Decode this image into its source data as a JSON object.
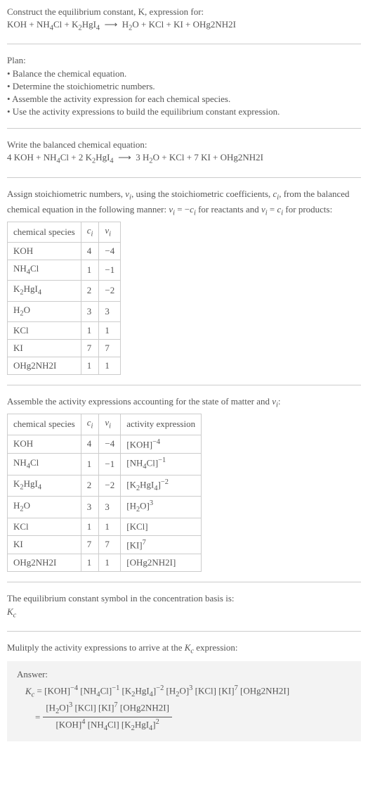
{
  "intro": {
    "line1": "Construct the equilibrium constant, K, expression for:",
    "line2": "KOH + NH₄Cl + K₂HgI₄ ⟶ H₂O + KCl + KI + OHg2NH2I"
  },
  "plan": {
    "heading": "Plan:",
    "items": [
      "• Balance the chemical equation.",
      "• Determine the stoichiometric numbers.",
      "• Assemble the activity expression for each chemical species.",
      "• Use the activity expressions to build the equilibrium constant expression."
    ]
  },
  "balanced": {
    "heading": "Write the balanced chemical equation:",
    "equation": "4 KOH + NH₄Cl + 2 K₂HgI₄ ⟶ 3 H₂O + KCl + 7 KI + OHg2NH2I"
  },
  "assign": {
    "text": "Assign stoichiometric numbers, νᵢ, using the stoichiometric coefficients, cᵢ, from the balanced chemical equation in the following manner: νᵢ = −cᵢ for reactants and νᵢ = cᵢ for products:"
  },
  "table1": {
    "headers": [
      "chemical species",
      "cᵢ",
      "νᵢ"
    ],
    "rows": [
      [
        "KOH",
        "4",
        "−4"
      ],
      [
        "NH₄Cl",
        "1",
        "−1"
      ],
      [
        "K₂HgI₄",
        "2",
        "−2"
      ],
      [
        "H₂O",
        "3",
        "3"
      ],
      [
        "KCl",
        "1",
        "1"
      ],
      [
        "KI",
        "7",
        "7"
      ],
      [
        "OHg2NH2I",
        "1",
        "1"
      ]
    ]
  },
  "assemble": {
    "text": "Assemble the activity expressions accounting for the state of matter and νᵢ:"
  },
  "table2": {
    "headers": [
      "chemical species",
      "cᵢ",
      "νᵢ",
      "activity expression"
    ],
    "rows": [
      [
        "KOH",
        "4",
        "−4",
        "[KOH]⁻⁴"
      ],
      [
        "NH₄Cl",
        "1",
        "−1",
        "[NH₄Cl]⁻¹"
      ],
      [
        "K₂HgI₄",
        "2",
        "−2",
        "[K₂HgI₄]⁻²"
      ],
      [
        "H₂O",
        "3",
        "3",
        "[H₂O]³"
      ],
      [
        "KCl",
        "1",
        "1",
        "[KCl]"
      ],
      [
        "KI",
        "7",
        "7",
        "[KI]⁷"
      ],
      [
        "OHg2NH2I",
        "1",
        "1",
        "[OHg2NH2I]"
      ]
    ]
  },
  "symbol": {
    "line1": "The equilibrium constant symbol in the concentration basis is:",
    "line2": "K_c"
  },
  "mult": {
    "text": "Mulitply the activity expressions to arrive at the K_c expression:"
  },
  "answer": {
    "label": "Answer:",
    "eq1": "K_c = [KOH]⁻⁴ [NH₄Cl]⁻¹ [K₂HgI₄]⁻² [H₂O]³ [KCl] [KI]⁷ [OHg2NH2I]",
    "eq2prefix": "= ",
    "num": "[H₂O]³ [KCl] [KI]⁷ [OHg2NH2I]",
    "den": "[KOH]⁴ [NH₄Cl] [K₂HgI₄]²"
  },
  "chart_data": {
    "type": "table",
    "tables": [
      {
        "title": "Stoichiometric numbers",
        "columns": [
          "chemical species",
          "c_i",
          "ν_i"
        ],
        "rows": [
          {
            "chemical species": "KOH",
            "c_i": 4,
            "ν_i": -4
          },
          {
            "chemical species": "NH4Cl",
            "c_i": 1,
            "ν_i": -1
          },
          {
            "chemical species": "K2HgI4",
            "c_i": 2,
            "ν_i": -2
          },
          {
            "chemical species": "H2O",
            "c_i": 3,
            "ν_i": 3
          },
          {
            "chemical species": "KCl",
            "c_i": 1,
            "ν_i": 1
          },
          {
            "chemical species": "KI",
            "c_i": 7,
            "ν_i": 7
          },
          {
            "chemical species": "OHg2NH2I",
            "c_i": 1,
            "ν_i": 1
          }
        ]
      },
      {
        "title": "Activity expressions",
        "columns": [
          "chemical species",
          "c_i",
          "ν_i",
          "activity expression"
        ],
        "rows": [
          {
            "chemical species": "KOH",
            "c_i": 4,
            "ν_i": -4,
            "activity expression": "[KOH]^-4"
          },
          {
            "chemical species": "NH4Cl",
            "c_i": 1,
            "ν_i": -1,
            "activity expression": "[NH4Cl]^-1"
          },
          {
            "chemical species": "K2HgI4",
            "c_i": 2,
            "ν_i": -2,
            "activity expression": "[K2HgI4]^-2"
          },
          {
            "chemical species": "H2O",
            "c_i": 3,
            "ν_i": 3,
            "activity expression": "[H2O]^3"
          },
          {
            "chemical species": "KCl",
            "c_i": 1,
            "ν_i": 1,
            "activity expression": "[KCl]"
          },
          {
            "chemical species": "KI",
            "c_i": 7,
            "ν_i": 7,
            "activity expression": "[KI]^7"
          },
          {
            "chemical species": "OHg2NH2I",
            "c_i": 1,
            "ν_i": 1,
            "activity expression": "[OHg2NH2I]"
          }
        ]
      }
    ]
  }
}
